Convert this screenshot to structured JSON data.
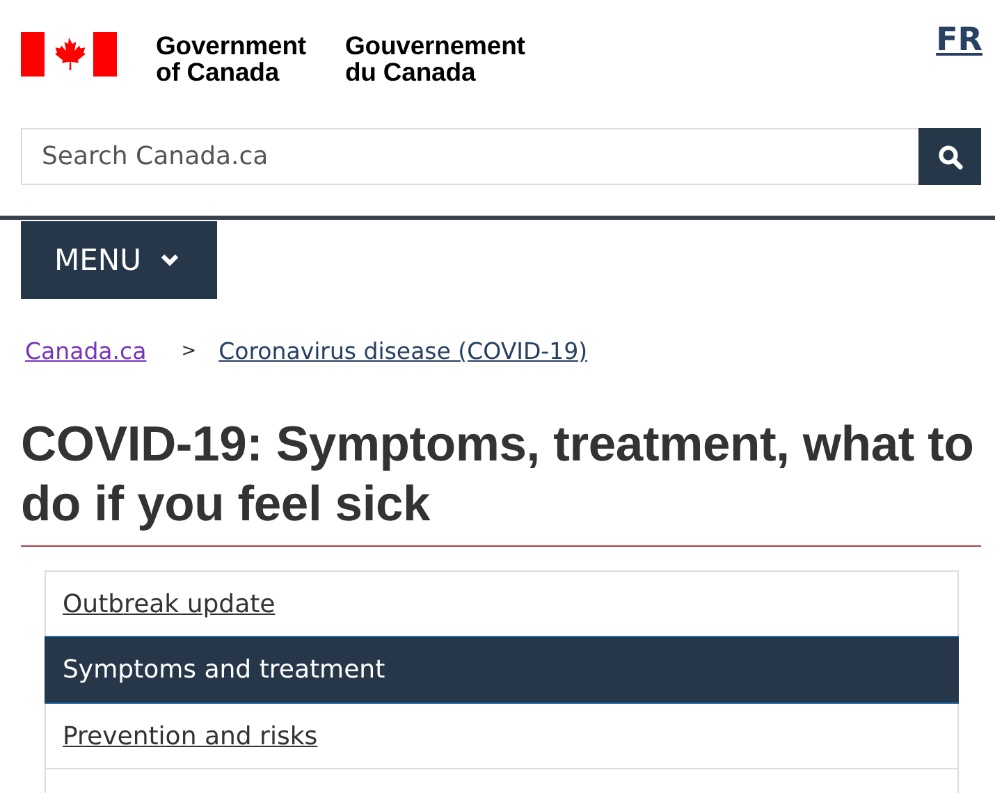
{
  "header": {
    "signature_en": [
      "Government",
      "of Canada"
    ],
    "signature_fr": [
      "Gouvernement",
      "du Canada"
    ],
    "language_toggle": "FR"
  },
  "search": {
    "placeholder": "Search Canada.ca"
  },
  "menu": {
    "label": "MENU"
  },
  "breadcrumbs": {
    "separator": ">",
    "items": [
      {
        "label": "Canada.ca",
        "visited": true
      },
      {
        "label": "Coronavirus disease (COVID-19)",
        "visited": false
      }
    ]
  },
  "title": "COVID-19: Symptoms, treatment, what to do if you feel sick",
  "section_nav": [
    {
      "label": "Outbreak update",
      "selected": false
    },
    {
      "label": "Symptoms and treatment",
      "selected": true
    },
    {
      "label": "Prevention and risks",
      "selected": false
    }
  ]
}
